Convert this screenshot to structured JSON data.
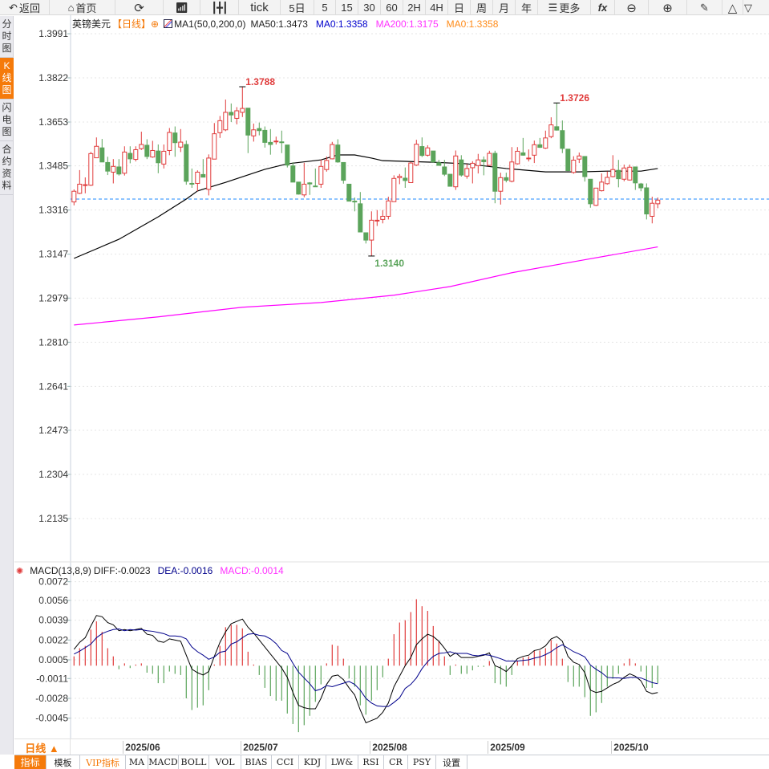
{
  "toolbar": {
    "back": "返回",
    "home": "首页",
    "tick": "tick",
    "5d": "5日",
    "m5": "5",
    "m15": "15",
    "m30": "30",
    "m60": "60",
    "h2": "2H",
    "h4": "4H",
    "day": "日",
    "week": "周",
    "month": "月",
    "year": "年",
    "more": "更多",
    "fx": "fx"
  },
  "left_tabs": [
    {
      "label": [
        "分",
        "时",
        "图"
      ]
    },
    {
      "label": [
        "K",
        "线",
        "图"
      ],
      "active": true
    },
    {
      "label": [
        "闪",
        "电",
        "图"
      ]
    },
    {
      "label": [
        "合",
        "约",
        "资",
        "料"
      ]
    }
  ],
  "legend": {
    "symbol": "英镑美元",
    "period": "【日线】",
    "ma_name": "MA1(50,0,200,0)",
    "ma50": "MA50:1.3473",
    "ma0_blue": "MA0:1.3358",
    "ma200": "MA200:1.3175",
    "ma0_orange": "MA0:1.3358"
  },
  "macd_legend": {
    "name": "MACD(13,8,9)",
    "diff": "DIFF:-0.0023",
    "dea": "DEA:-0.0016",
    "macd": "MACD:-0.0014"
  },
  "colors": {
    "up": "#e03b3b",
    "down": "#5ba45b",
    "ma50": "#000000",
    "ma200": "#ff00ff",
    "last": "#1e88ff",
    "dea": "#00008b",
    "accent": "#f57a0a"
  },
  "price_axis": [
    "1.3991",
    "1.3822",
    "1.3653",
    "1.3485",
    "1.3316",
    "1.3147",
    "1.2979",
    "1.2810",
    "1.2641",
    "1.2473",
    "1.2304",
    "1.2135"
  ],
  "macd_axis": [
    "0.0072",
    "0.0056",
    "0.0039",
    "0.0022",
    "0.0005",
    "-0.0011",
    "-0.0028",
    "-0.0045"
  ],
  "annotations": {
    "high1": "1.3788",
    "high2": "1.3726",
    "low1": "1.3140"
  },
  "period_selector": "日线 ▲",
  "dates": [
    {
      "label": "2025/06",
      "index": 10
    },
    {
      "label": "2025/07",
      "index": 31
    },
    {
      "label": "2025/08",
      "index": 54
    },
    {
      "label": "2025/09",
      "index": 75
    },
    {
      "label": "2025/10",
      "index": 97
    }
  ],
  "bottom_tabs": [
    "指标",
    "模板",
    "VIP指标",
    "MA",
    "MACD",
    "BOLL",
    "VOL",
    "BIAS",
    "CCI",
    "KDJ",
    "LW&",
    "RSI",
    "CR",
    "PSY",
    "设置"
  ],
  "chart_data": {
    "type": "candlestick",
    "last_price": 1.3358,
    "ylim": [
      1.2135,
      1.3991
    ],
    "candles_ohlc": [
      [
        1.3347,
        1.3395,
        1.3334,
        1.3388
      ],
      [
        1.338,
        1.3469,
        1.3377,
        1.3415
      ],
      [
        1.3411,
        1.3441,
        1.338,
        1.3413
      ],
      [
        1.3411,
        1.3539,
        1.3408,
        1.3532
      ],
      [
        1.3516,
        1.3594,
        1.3516,
        1.356
      ],
      [
        1.3554,
        1.3588,
        1.35,
        1.35
      ],
      [
        1.3498,
        1.352,
        1.345,
        1.3465
      ],
      [
        1.3461,
        1.3511,
        1.3418,
        1.3483
      ],
      [
        1.3481,
        1.3511,
        1.3448,
        1.3454
      ],
      [
        1.3457,
        1.356,
        1.3448,
        1.3538
      ],
      [
        1.3533,
        1.356,
        1.3495,
        1.3512
      ],
      [
        1.351,
        1.356,
        1.3502,
        1.3547
      ],
      [
        1.3551,
        1.3616,
        1.3546,
        1.3567
      ],
      [
        1.3564,
        1.3587,
        1.3511,
        1.3521
      ],
      [
        1.3519,
        1.3581,
        1.3516,
        1.3544
      ],
      [
        1.3542,
        1.3567,
        1.3457,
        1.3497
      ],
      [
        1.3492,
        1.3567,
        1.3475,
        1.3541
      ],
      [
        1.3544,
        1.363,
        1.3526,
        1.3613
      ],
      [
        1.3611,
        1.3636,
        1.352,
        1.3574
      ],
      [
        1.3557,
        1.3626,
        1.3538,
        1.3576
      ],
      [
        1.3567,
        1.3582,
        1.3413,
        1.3426
      ],
      [
        1.3418,
        1.3475,
        1.3401,
        1.3415
      ],
      [
        1.3418,
        1.3468,
        1.3388,
        1.3461
      ],
      [
        1.3452,
        1.3511,
        1.3442,
        1.3442
      ],
      [
        1.3395,
        1.3529,
        1.3372,
        1.3515
      ],
      [
        1.3511,
        1.3649,
        1.3511,
        1.3608
      ],
      [
        1.3612,
        1.3676,
        1.3592,
        1.3658
      ],
      [
        1.3623,
        1.3739,
        1.3618,
        1.369
      ],
      [
        1.369,
        1.3724,
        1.3653,
        1.368
      ],
      [
        1.3667,
        1.371,
        1.3644,
        1.3696
      ],
      [
        1.369,
        1.3788,
        1.3672,
        1.3705
      ],
      [
        1.3706,
        1.3706,
        1.3534,
        1.3603
      ],
      [
        1.36,
        1.3647,
        1.3578,
        1.3623
      ],
      [
        1.3628,
        1.3651,
        1.3602,
        1.362
      ],
      [
        1.3621,
        1.3636,
        1.3555,
        1.3575
      ],
      [
        1.3575,
        1.3626,
        1.3528,
        1.3567
      ],
      [
        1.3578,
        1.3597,
        1.3567,
        1.358
      ],
      [
        1.3577,
        1.362,
        1.3534,
        1.3574
      ],
      [
        1.3565,
        1.3565,
        1.3479,
        1.3488
      ],
      [
        1.3485,
        1.3499,
        1.3423,
        1.3423
      ],
      [
        1.3423,
        1.3423,
        1.3375,
        1.3377
      ],
      [
        1.3374,
        1.3497,
        1.3365,
        1.3415
      ],
      [
        1.342,
        1.3423,
        1.3374,
        1.3416
      ],
      [
        1.3408,
        1.3475,
        1.3405,
        1.3405
      ],
      [
        1.3415,
        1.3509,
        1.3401,
        1.3483
      ],
      [
        1.3471,
        1.3521,
        1.3463,
        1.3506
      ],
      [
        1.3512,
        1.3577,
        1.351,
        1.3567
      ],
      [
        1.3565,
        1.3587,
        1.3497,
        1.35
      ],
      [
        1.3498,
        1.3498,
        1.3417,
        1.343
      ],
      [
        1.3415,
        1.3415,
        1.335,
        1.335
      ],
      [
        1.335,
        1.3364,
        1.3311,
        1.3348
      ],
      [
        1.334,
        1.3385,
        1.3232,
        1.3232
      ],
      [
        1.3229,
        1.3229,
        1.3188,
        1.3201
      ],
      [
        1.3201,
        1.3311,
        1.314,
        1.3277
      ],
      [
        1.3274,
        1.3316,
        1.3255,
        1.3277
      ],
      [
        1.328,
        1.3316,
        1.3265,
        1.3292
      ],
      [
        1.3292,
        1.3367,
        1.328,
        1.3351
      ],
      [
        1.3348,
        1.3449,
        1.3348,
        1.3437
      ],
      [
        1.344,
        1.3454,
        1.3415,
        1.3445
      ],
      [
        1.3438,
        1.3479,
        1.3401,
        1.3429
      ],
      [
        1.3421,
        1.35,
        1.3421,
        1.3496
      ],
      [
        1.3488,
        1.3585,
        1.3485,
        1.3568
      ],
      [
        1.3559,
        1.3594,
        1.3519,
        1.3525
      ],
      [
        1.3526,
        1.3564,
        1.3521,
        1.3554
      ],
      [
        1.3542,
        1.3542,
        1.3497,
        1.35
      ],
      [
        1.3497,
        1.3508,
        1.3487,
        1.3487
      ],
      [
        1.3481,
        1.3508,
        1.3446,
        1.3453
      ],
      [
        1.3453,
        1.3453,
        1.3407,
        1.3407
      ],
      [
        1.3405,
        1.3544,
        1.3393,
        1.3523
      ],
      [
        1.3508,
        1.3526,
        1.3444,
        1.345
      ],
      [
        1.3446,
        1.3492,
        1.3436,
        1.3475
      ],
      [
        1.3478,
        1.3503,
        1.3418,
        1.3495
      ],
      [
        1.3486,
        1.3531,
        1.3456,
        1.3508
      ],
      [
        1.3508,
        1.3521,
        1.3449,
        1.3501
      ],
      [
        1.3487,
        1.3543,
        1.3485,
        1.3533
      ],
      [
        1.3533,
        1.3543,
        1.3342,
        1.3388
      ],
      [
        1.3388,
        1.3459,
        1.3337,
        1.344
      ],
      [
        1.344,
        1.3459,
        1.3422,
        1.343
      ],
      [
        1.3426,
        1.3557,
        1.3422,
        1.35
      ],
      [
        1.3493,
        1.3557,
        1.349,
        1.3541
      ],
      [
        1.3535,
        1.3592,
        1.3524,
        1.3526
      ],
      [
        1.3513,
        1.3548,
        1.3502,
        1.3515
      ],
      [
        1.3526,
        1.3582,
        1.3496,
        1.3566
      ],
      [
        1.3566,
        1.3592,
        1.3554,
        1.3556
      ],
      [
        1.3553,
        1.362,
        1.355,
        1.3592
      ],
      [
        1.3597,
        1.3671,
        1.3591,
        1.3642
      ],
      [
        1.3635,
        1.3726,
        1.362,
        1.3622
      ],
      [
        1.362,
        1.3659,
        1.3534,
        1.3552
      ],
      [
        1.3549,
        1.3549,
        1.3465,
        1.3467
      ],
      [
        1.346,
        1.3522,
        1.3455,
        1.3507
      ],
      [
        1.3511,
        1.3536,
        1.3496,
        1.3523
      ],
      [
        1.3521,
        1.3521,
        1.3425,
        1.3444
      ],
      [
        1.3434,
        1.3434,
        1.3325,
        1.334
      ],
      [
        1.3334,
        1.34,
        1.3331,
        1.34
      ],
      [
        1.339,
        1.3456,
        1.3387,
        1.3423
      ],
      [
        1.3417,
        1.3464,
        1.3413,
        1.3441
      ],
      [
        1.3444,
        1.3526,
        1.3441,
        1.3471
      ],
      [
        1.3468,
        1.3508,
        1.3403,
        1.3436
      ],
      [
        1.3434,
        1.349,
        1.3426,
        1.3477
      ],
      [
        1.3431,
        1.349,
        1.3429,
        1.348
      ],
      [
        1.3481,
        1.3481,
        1.3393,
        1.342
      ],
      [
        1.3416,
        1.342,
        1.3388,
        1.3401
      ],
      [
        1.3401,
        1.3418,
        1.328,
        1.3301
      ],
      [
        1.3292,
        1.3367,
        1.3265,
        1.3342
      ],
      [
        1.334,
        1.3364,
        1.3323,
        1.3354
      ]
    ],
    "ma50": [
      [
        1,
        1.3131
      ],
      [
        9,
        1.3204
      ],
      [
        16,
        1.329
      ],
      [
        21,
        1.3358
      ],
      [
        23,
        1.3389
      ],
      [
        28,
        1.3422
      ],
      [
        35,
        1.3472
      ],
      [
        39,
        1.3493
      ],
      [
        45,
        1.3508
      ],
      [
        48,
        1.3527
      ],
      [
        51,
        1.3527
      ],
      [
        54,
        1.3515
      ],
      [
        56,
        1.3505
      ],
      [
        65,
        1.3499
      ],
      [
        71,
        1.3493
      ],
      [
        78,
        1.3475
      ],
      [
        85,
        1.3462
      ],
      [
        91,
        1.3462
      ],
      [
        96,
        1.3465
      ],
      [
        102,
        1.3465
      ],
      [
        105,
        1.3475
      ]
    ],
    "ma200": [
      [
        1,
        1.2876
      ],
      [
        16,
        1.2907
      ],
      [
        31,
        1.2944
      ],
      [
        45,
        1.2962
      ],
      [
        58,
        1.299
      ],
      [
        68,
        1.3023
      ],
      [
        79,
        1.3076
      ],
      [
        91,
        1.3122
      ],
      [
        105,
        1.3175
      ]
    ],
    "macd": {
      "ylim": [
        -0.0052,
        0.0072
      ],
      "hist": [
        0.0008,
        0.0015,
        0.0017,
        0.0031,
        0.0038,
        0.0029,
        0.0015,
        0.0008,
        -0.0003,
        0.0002,
        -0.0002,
        0.0001,
        0.0002,
        -0.0006,
        -0.0007,
        -0.0015,
        -0.0015,
        -0.0005,
        -0.0007,
        -0.0008,
        -0.0028,
        -0.0038,
        -0.0036,
        -0.0034,
        -0.0021,
        0.0001,
        0.0017,
        0.0033,
        0.0035,
        0.0035,
        0.0032,
        0.0012,
        0.0001,
        -0.0008,
        -0.0019,
        -0.0026,
        -0.003,
        -0.003,
        -0.0041,
        -0.005,
        -0.0057,
        -0.0051,
        -0.0043,
        -0.0031,
        -0.0016,
        0.0002,
        0.0018,
        0.0017,
        0.0006,
        -0.0011,
        -0.0018,
        -0.0034,
        -0.0042,
        -0.003,
        -0.0021,
        -0.001,
        0.0006,
        0.0027,
        0.0037,
        0.0039,
        0.0046,
        0.0057,
        0.0051,
        0.0047,
        0.0034,
        0.0021,
        0.0008,
        -0.0008,
        0.0001,
        -0.0007,
        -0.0007,
        -0.0004,
        -0.0001,
        -0.0001,
        0.0004,
        -0.0015,
        -0.0016,
        -0.0018,
        -0.0008,
        0.0004,
        0.0007,
        0.0008,
        0.0013,
        0.0013,
        0.0015,
        0.0022,
        0.0019,
        0.0006,
        -0.0014,
        -0.0018,
        -0.0018,
        -0.0027,
        -0.0043,
        -0.004,
        -0.0032,
        -0.0018,
        -0.0011,
        -0.0007,
        0.0002,
        0.0006,
        0.0002,
        -0.0005,
        -0.0019,
        -0.0019,
        -0.0015
      ],
      "diff": [
        0.0014,
        0.002,
        0.0024,
        0.0034,
        0.0043,
        0.0042,
        0.0037,
        0.0035,
        0.003,
        0.0031,
        0.003,
        0.0031,
        0.0032,
        0.0027,
        0.0026,
        0.0021,
        0.002,
        0.0023,
        0.0022,
        0.0021,
        0.0009,
        -0.0003,
        -0.0006,
        -0.0008,
        -0.0005,
        0.0008,
        0.002,
        0.0029,
        0.0036,
        0.0038,
        0.004,
        0.0033,
        0.0028,
        0.0022,
        0.0016,
        0.001,
        0.0004,
        -0.0002,
        -0.001,
        -0.0023,
        -0.0034,
        -0.0036,
        -0.0037,
        -0.0037,
        -0.0028,
        -0.0016,
        -0.0009,
        -0.0008,
        -0.0012,
        -0.0019,
        -0.0025,
        -0.0038,
        -0.0049,
        -0.0047,
        -0.0045,
        -0.004,
        -0.0032,
        -0.0018,
        -0.0009,
        0.0,
        0.0007,
        0.0018,
        0.0023,
        0.0027,
        0.0025,
        0.0021,
        0.0015,
        0.0008,
        0.0011,
        0.0007,
        0.0007,
        0.0007,
        0.0008,
        0.0009,
        0.0011,
        0.0,
        -0.0002,
        -0.0005,
        0.0,
        0.0006,
        0.0008,
        0.0009,
        0.0013,
        0.0014,
        0.0017,
        0.0023,
        0.0025,
        0.0021,
        0.0008,
        0.0003,
        0.0001,
        -0.0006,
        -0.0021,
        -0.0023,
        -0.0022,
        -0.0019,
        -0.0016,
        -0.0014,
        -0.001,
        -0.0007,
        -0.0009,
        -0.0013,
        -0.0022,
        -0.0024,
        -0.0023
      ]
    }
  }
}
